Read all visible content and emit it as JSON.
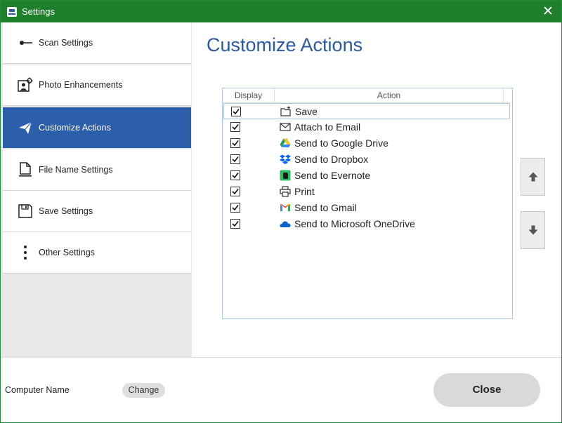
{
  "window": {
    "title": "Settings",
    "close_glyph": "✕"
  },
  "sidebar": {
    "items": [
      {
        "label": "Scan Settings",
        "icon": "scan-settings-icon"
      },
      {
        "label": "Photo Enhancements",
        "icon": "photo-enhancements-icon"
      },
      {
        "label": "Customize Actions",
        "icon": "paper-plane-icon",
        "selected": true
      },
      {
        "label": "File Name Settings",
        "icon": "file-name-icon"
      },
      {
        "label": "Save Settings",
        "icon": "floppy-disk-icon"
      },
      {
        "label": "Other Settings",
        "icon": "vertical-dots-icon"
      }
    ]
  },
  "main": {
    "title": "Customize Actions",
    "list": {
      "headers": {
        "display": "Display",
        "action": "Action"
      },
      "rows": [
        {
          "checked": true,
          "label": "Save",
          "icon": "save-icon"
        },
        {
          "checked": true,
          "label": "Attach to Email",
          "icon": "email-icon"
        },
        {
          "checked": true,
          "label": "Send to Google Drive",
          "icon": "google-drive-icon"
        },
        {
          "checked": true,
          "label": "Send to Dropbox",
          "icon": "dropbox-icon"
        },
        {
          "checked": true,
          "label": "Send to Evernote",
          "icon": "evernote-icon"
        },
        {
          "checked": true,
          "label": "Print",
          "icon": "printer-icon"
        },
        {
          "checked": true,
          "label": "Send to Gmail",
          "icon": "gmail-icon"
        },
        {
          "checked": true,
          "label": "Send to Microsoft OneDrive",
          "icon": "onedrive-icon"
        }
      ]
    },
    "move_up_icon": "arrow-up-icon",
    "move_down_icon": "arrow-down-icon"
  },
  "footer": {
    "computer_name_label": "Computer Name",
    "change_label": "Change",
    "close_label": "Close"
  },
  "colors": {
    "titlebar": "#1e7f2d",
    "accent": "#2c5fab",
    "title_text": "#2b5aa0"
  }
}
